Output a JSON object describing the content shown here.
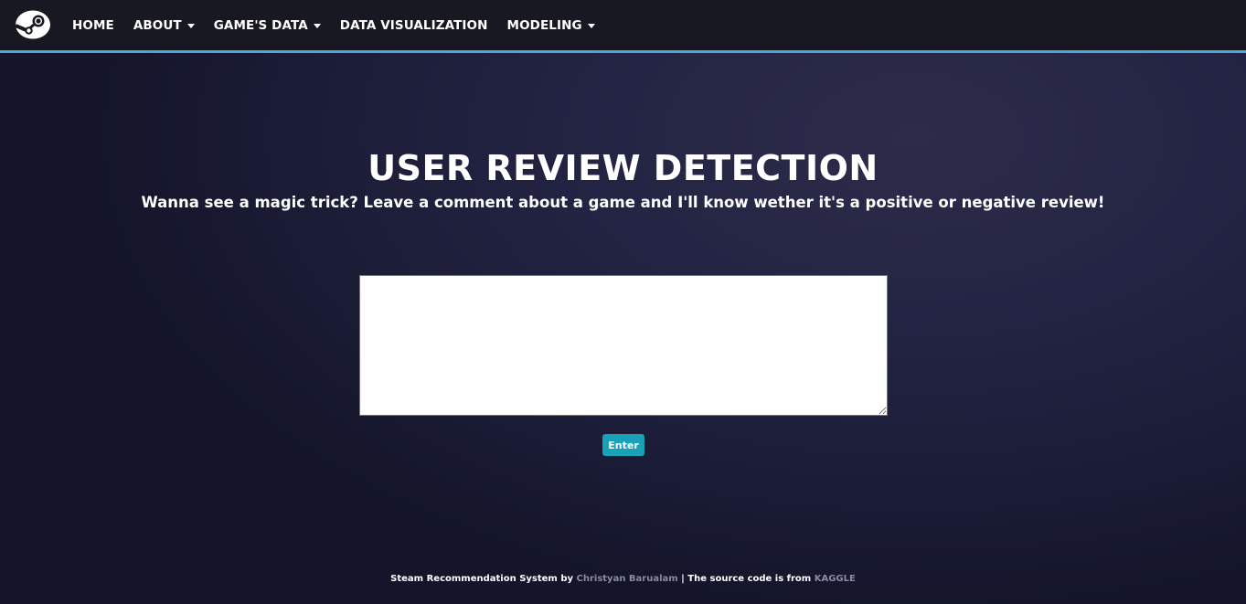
{
  "nav": {
    "items": [
      {
        "label": "HOME",
        "dropdown": false
      },
      {
        "label": "ABOUT",
        "dropdown": true
      },
      {
        "label": "GAME'S DATA",
        "dropdown": true
      },
      {
        "label": "DATA VISUALIZATION",
        "dropdown": false
      },
      {
        "label": "MODELING",
        "dropdown": true
      }
    ],
    "accent_color": "#4aa8dd",
    "logo_icon": "steam-logo-icon"
  },
  "main": {
    "title": "USER REVIEW DETECTION",
    "subtitle": "Wanna see a magic trick? Leave a comment about a game and I'll know wether it's a positive or negative review!",
    "review_input_value": "",
    "enter_label": "Enter",
    "button_color": "#17a2b8"
  },
  "footer": {
    "prefix": "Steam Recommendation System by ",
    "author": "Christyan Barualam",
    "separator": " | The source code is from ",
    "source": "KAGGLE"
  }
}
